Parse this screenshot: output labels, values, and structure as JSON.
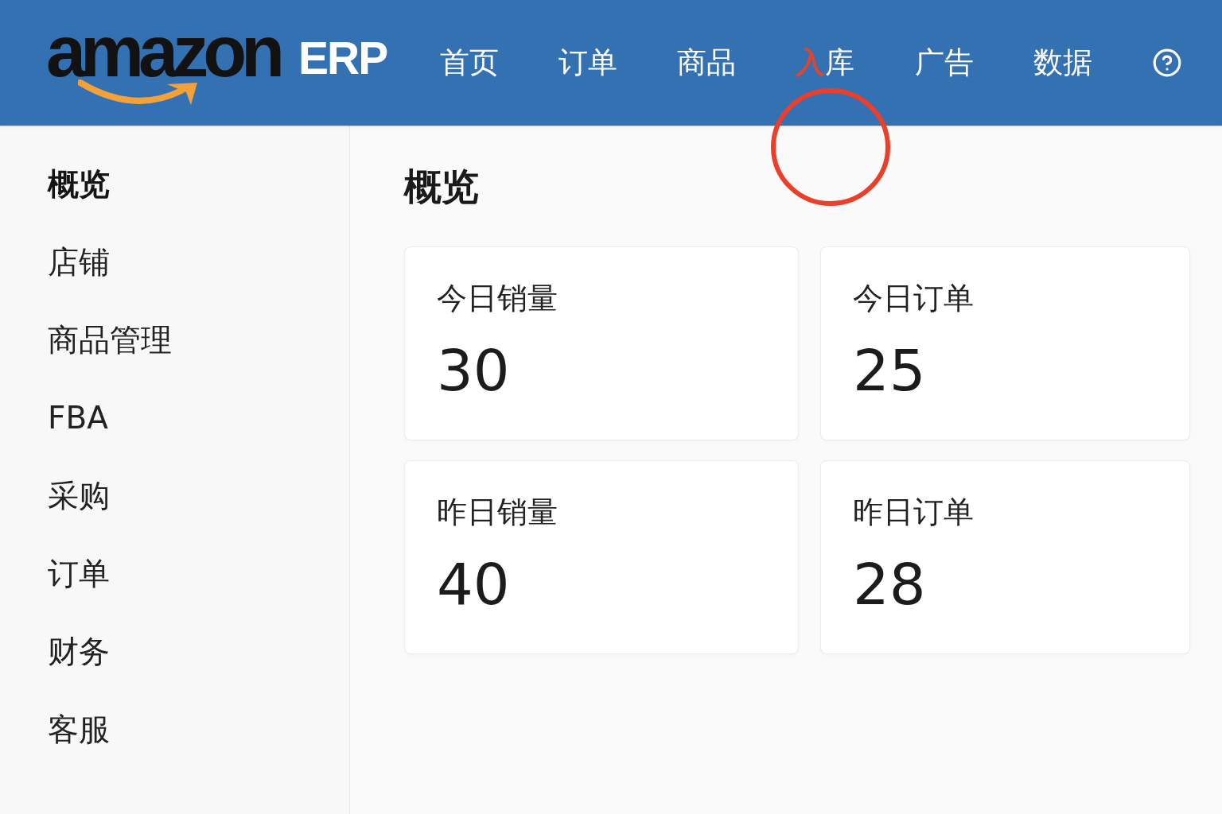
{
  "header": {
    "logo": {
      "wordmark": "amazon",
      "product": "ERP"
    },
    "nav": [
      {
        "label": "首页",
        "marked": false
      },
      {
        "label": "订单",
        "marked": false
      },
      {
        "label": "商品",
        "marked": false
      },
      {
        "label": "入库",
        "marked": true
      },
      {
        "label": "广告",
        "marked": false
      },
      {
        "label": "数据",
        "marked": false
      }
    ]
  },
  "sidebar": {
    "items": [
      {
        "label": "概览",
        "selected": true
      },
      {
        "label": "店铺",
        "selected": false
      },
      {
        "label": "商品管理",
        "selected": false
      },
      {
        "label": "FBA",
        "selected": false
      },
      {
        "label": "采购",
        "selected": false
      },
      {
        "label": "订单",
        "selected": false
      },
      {
        "label": "财务",
        "selected": false
      },
      {
        "label": "客服",
        "selected": false
      }
    ]
  },
  "main": {
    "title": "概览",
    "cards": [
      {
        "label": "今日销量",
        "value": "30"
      },
      {
        "label": "今日订单",
        "value": "25"
      },
      {
        "label": "昨日销量",
        "value": "40"
      },
      {
        "label": "昨日订单",
        "value": "28"
      }
    ]
  },
  "annotations": [
    {
      "kind": "circle"
    }
  ]
}
